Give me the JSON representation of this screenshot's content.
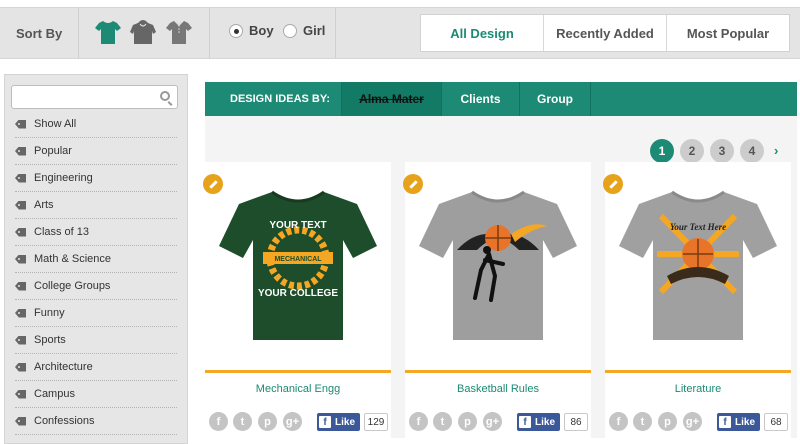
{
  "sortbar": {
    "label": "Sort By",
    "garments": [
      {
        "name": "tshirt-icon",
        "color": "#1c8a74"
      },
      {
        "name": "hoodie-icon",
        "color": "#666666"
      },
      {
        "name": "polo-icon",
        "color": "#777777"
      }
    ],
    "gender": [
      {
        "label": "Boy",
        "selected": true
      },
      {
        "label": "Girl",
        "selected": false
      }
    ],
    "tabs": [
      {
        "label": "All Design",
        "active": true
      },
      {
        "label": "Recently Added",
        "active": false
      },
      {
        "label": "Most Popular",
        "active": false
      }
    ]
  },
  "sidebar": {
    "search_placeholder": "",
    "categories": [
      "Show All",
      "Popular",
      "Engineering",
      "Arts",
      "Class of 13",
      "Math & Science",
      "College Groups",
      "Funny",
      "Sports",
      "Architecture",
      "Campus",
      "Confessions"
    ]
  },
  "design_bar": {
    "label": "DESIGN IDEAS BY:",
    "items": [
      {
        "label": "Alma Mater",
        "active": true
      },
      {
        "label": "Clients",
        "active": false
      },
      {
        "label": "Group",
        "active": false
      }
    ]
  },
  "pagination": {
    "pages": [
      "1",
      "2",
      "3",
      "4"
    ],
    "active": "1",
    "next": "›"
  },
  "products": [
    {
      "title": "Mechanical Engg",
      "shirt_color": "#1d4d2a",
      "likes": "129",
      "like_label": "Like"
    },
    {
      "title": "Basketball Rules",
      "shirt_color": "#9e9e9e",
      "likes": "86",
      "like_label": "Like"
    },
    {
      "title": "Literature",
      "shirt_color": "#a0a0a0",
      "likes": "68",
      "like_label": "Like"
    }
  ],
  "social_icons": [
    "facebook-icon",
    "twitter-icon",
    "pinterest-icon",
    "google-plus-icon"
  ],
  "colors": {
    "accent": "#1c8a74",
    "orange": "#f5a623",
    "facebook": "#3b5998"
  }
}
